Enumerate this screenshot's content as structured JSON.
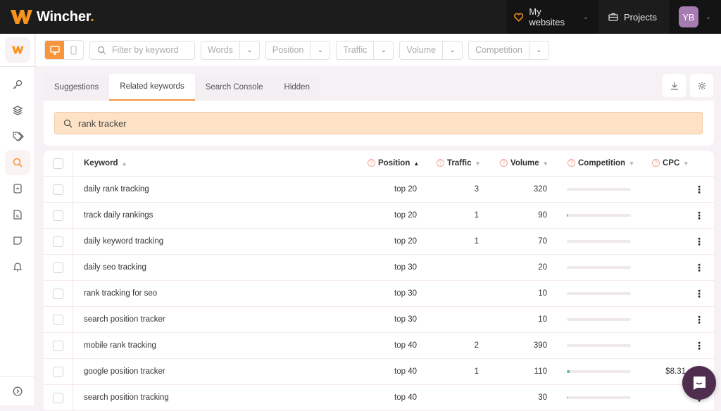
{
  "app": {
    "name": "Wincher",
    "brand_color": "#f7941d"
  },
  "topnav": {
    "my_websites": "My websites",
    "projects": "Projects",
    "user_initials": "YB",
    "avatar_color": "#a57bb2"
  },
  "sidebar": {
    "items": [
      {
        "icon": "key-icon",
        "label": "Keywords"
      },
      {
        "icon": "layers-icon",
        "label": "Groups"
      },
      {
        "icon": "tags-icon",
        "label": "Tags"
      },
      {
        "icon": "search-icon",
        "label": "Keyword research",
        "active": true
      },
      {
        "icon": "report-icon",
        "label": "Reports"
      },
      {
        "icon": "document-icon",
        "label": "Documents"
      },
      {
        "icon": "notes-icon",
        "label": "Notes"
      },
      {
        "icon": "bell-icon",
        "label": "Notifications"
      }
    ],
    "expand_icon": "chevron-right-circle-icon"
  },
  "toolbar": {
    "filter_placeholder": "Filter by keyword",
    "dropdowns": [
      "Words",
      "Position",
      "Traffic",
      "Volume",
      "Competition"
    ]
  },
  "tabs": [
    {
      "label": "Suggestions",
      "active": false
    },
    {
      "label": "Related keywords",
      "active": true
    },
    {
      "label": "Search Console",
      "active": false
    },
    {
      "label": "Hidden",
      "active": false
    }
  ],
  "search": {
    "value": "rank tracker"
  },
  "table": {
    "headers": {
      "keyword": "Keyword",
      "position": "Position",
      "traffic": "Traffic",
      "volume": "Volume",
      "competition": "Competition",
      "cpc": "CPC"
    },
    "rows": [
      {
        "keyword": "daily rank tracking",
        "position": "top 20",
        "traffic": "3",
        "volume": "320",
        "competition": 0,
        "cpc": ""
      },
      {
        "keyword": "track daily rankings",
        "position": "top 20",
        "traffic": "1",
        "volume": "90",
        "competition": 0.02,
        "cpc": ""
      },
      {
        "keyword": "daily keyword tracking",
        "position": "top 20",
        "traffic": "1",
        "volume": "70",
        "competition": 0,
        "cpc": ""
      },
      {
        "keyword": "daily seo tracking",
        "position": "top 30",
        "traffic": "",
        "volume": "20",
        "competition": 0,
        "cpc": ""
      },
      {
        "keyword": "rank tracking for seo",
        "position": "top 30",
        "traffic": "",
        "volume": "10",
        "competition": 0,
        "cpc": ""
      },
      {
        "keyword": "search position tracker",
        "position": "top 30",
        "traffic": "",
        "volume": "10",
        "competition": 0,
        "cpc": ""
      },
      {
        "keyword": "mobile rank tracking",
        "position": "top 40",
        "traffic": "2",
        "volume": "390",
        "competition": 0,
        "cpc": ""
      },
      {
        "keyword": "google position tracker",
        "position": "top 40",
        "traffic": "1",
        "volume": "110",
        "competition": 0.04,
        "cpc": "$8.31"
      },
      {
        "keyword": "search position tracking",
        "position": "top 40",
        "traffic": "",
        "volume": "30",
        "competition": 0.01,
        "cpc": ""
      }
    ]
  }
}
